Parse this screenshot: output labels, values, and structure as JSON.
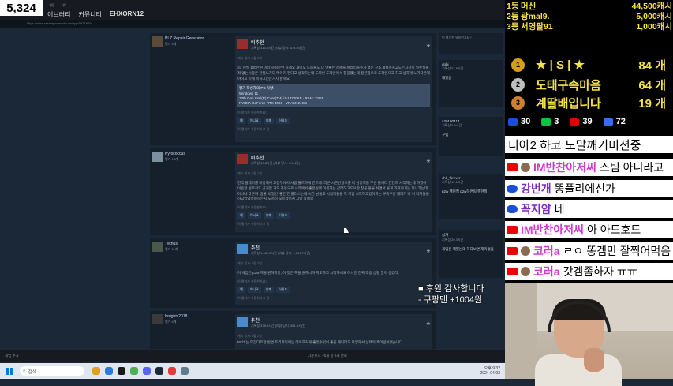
{
  "counter": "5,324",
  "nav": {
    "small_links": [
      "계정",
      "차트"
    ],
    "tabs": [
      "이브러리",
      "커뮤니티"
    ],
    "user": "EHXORN12",
    "url": "https://store.steampowered.com/app/1971870/..."
  },
  "reviews": [
    {
      "author": "PLZ Repair Generator",
      "author_sub": "평가 4개",
      "verdict": "비추천",
      "hours": "기록상 116.8시간 (리뷰 당시: 378.5시간)",
      "posted": "게시 일시: 4월 2일",
      "text": "음. 현질 100만원 이상 하실분만 하세요 재미도 드롭률도 다 안좋은 경제를 파라임을수가 없는 구조. 6월까지고도는시장이 필수필물적 없는시장은 한필느가다 메이커 편다고 생각하는데 도파인 도파인에서 힘을했는데 정원힘으로 도파인으고 하고 상하게 노가다만해야하고 이게 목하고인는거지 할까요.",
      "specs": [
        "평가 작성자의 PC 사양:",
        "Windows 11",
        "13th Gen Intel(R) Core(TM) i7-13700KF · RAM: 32GB",
        "NVIDIA GeForce RTX 4080 · VRAM: 24GB"
      ],
      "helpful_q": "이 평가가 유용한가요?",
      "buttons": [
        "예",
        "아니요",
        "유쾌",
        "어워드"
      ],
      "helpful_count": "이 평가가 유용하다고 함"
    },
    {
      "author": "Pyrococcus",
      "author_sub": "평가 13개",
      "verdict": "비추천",
      "hours": "기록상 13.8시간 (리뷰 당시: 9.9시간)",
      "posted": "게시 일시: 4월 2일",
      "text": "전작 플레이를 바탕에서 고점부에서 사람 뜰르하게 만드네. 다른 시즌인형으를 다 성공적을 부른 블세라 컨텐츠 시작하는데 하필이 이용한 성료적도 근처만 가도 자동으로 시작에서 좋은실에 이름하는 갈라하고도요한 창을 볼류 쉬면서 볼게 가져야기는 지나가는데 아니냐 다른하 '생물' 비밀번' 좋은 전'플러스는데 시간 남을고 시침이들을 작 게임 시작하고있어지는 쿠폭주면 재리가 나 이 더져들을 하고있었어야하는지 도저히 모르겠어서 그냥 삭제함",
      "helpful_q": "이 평가가 유용한가요?",
      "buttons": [
        "예",
        "아니요",
        "유쾌",
        "어워드"
      ],
      "helpful_count": "이 평가가 유용하다고 함"
    },
    {
      "author": "Tychus",
      "author_sub": "평가 11개",
      "verdict": "추천",
      "hours": "기록상 1,062.2시간 (리뷰 당시: 1,001.7시간)",
      "posted": "게시 일시: 4월 2일",
      "text": "이 게임은 p2w 핵을 원하지만, 이 것은 핵을 원하니까 지도하고 시작하세요 아니면 진짜 조용 상황 필이 생겼다.",
      "helpful_q": "이 평가가 유용한가요?",
      "buttons": [
        "예",
        "아니요",
        "유쾌",
        "어워드"
      ],
      "helpful_count": "이 평가가 유용하다고 함"
    },
    {
      "author": "Insights2018",
      "author_sub": "평가 4개",
      "verdict": "추천",
      "hours": "기록상 378.8시간 (리뷰 당시: 351.9시간)",
      "posted": "게시 일시: 4월 2일",
      "text": "PC버는 약간다르한 반면 트리퍼이에는 라이프처게 좋았수었어 좋을 캐릭터도 다양해서 선택의 폭이넓어졌습니다"
    }
  ],
  "side_reviews": [
    {
      "name": "이 평가가 유용한가요?",
      "sub": "",
      "text": ""
    },
    {
      "name": "dobi",
      "sub": "기록상 57.8시간",
      "text": "재밌음"
    },
    {
      "name": "a20190414",
      "sub": "기록상 5.6시간",
      "text": "구림"
    },
    {
      "name": "chk_forever",
      "sub": "기록상 12.6시간",
      "text": "p2w 핵현질 p2w하면됩 핵현질"
    },
    {
      "name": "삼개",
      "sub": "기록상 20.3시간",
      "text": "게임은 재밌는데 하다보면 재미없음"
    }
  ],
  "bottom": {
    "left": "게임 추가",
    "center": "다운로드 - 5개 중 5개 완료"
  },
  "taskbar": {
    "search_placeholder": "검색",
    "time": "오후 9:32",
    "date": "2024-04-02"
  },
  "donors": [
    {
      "rank": "1등",
      "name": "머신",
      "amount": "44,500캐시"
    },
    {
      "rank": "2등",
      "name": "광mal9.",
      "amount": "5,000캐시"
    },
    {
      "rank": "3등",
      "name": "서영팔91",
      "amount": "1,000캐시"
    }
  ],
  "ranking": [
    {
      "place": "1",
      "name": "★ | S | ★",
      "count": "84 개",
      "color": "#d4a017"
    },
    {
      "place": "2",
      "name": "도태구속마음",
      "count": "64 개",
      "color": "#c0c0c0"
    },
    {
      "place": "3",
      "name": "계딸배입니다",
      "count": "19 개",
      "color": "#cd7f32"
    }
  ],
  "counts": [
    {
      "icon": "infinity-icon",
      "value": "30",
      "color": "#1a4fd8"
    },
    {
      "icon": "chzzk-icon",
      "value": "3",
      "color": "#00c73c"
    },
    {
      "icon": "youtube-icon",
      "value": "39",
      "color": "#e00000"
    },
    {
      "icon": "waverse-icon",
      "value": "72",
      "color": "#3a6ee8"
    }
  ],
  "chat": {
    "title": "디아2 하코 노말깨기미션중",
    "messages": [
      {
        "platform": "yt",
        "user": "IM반찬아저씨",
        "text": "스팀 아니라고"
      },
      {
        "platform": "inf",
        "user": "강번개",
        "text": "똥플리에신가"
      },
      {
        "platform": "inf",
        "user": "꼭지얌",
        "text": "네"
      },
      {
        "platform": "yt",
        "user": "IM반찬아저씨",
        "text": "아 아드호드"
      },
      {
        "platform": "yt",
        "user": "코러a",
        "text": "ㄹㅇ 똥겜만 잘찍어먹음"
      },
      {
        "platform": "yt",
        "user": "코러a",
        "text": "갓겜좀하자 ㅠㅠ"
      }
    ]
  },
  "donation_alert": {
    "line1": "후원 감사합니다",
    "line2": "- 쿠팡맨 +1004원"
  }
}
